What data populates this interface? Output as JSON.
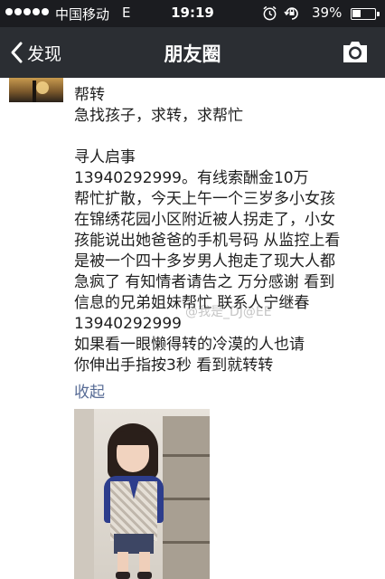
{
  "status_bar": {
    "carrier": "中国移动",
    "network": "E",
    "time": "19:19",
    "battery_percent": "39%",
    "battery_level": 0.39
  },
  "nav": {
    "back_label": "发现",
    "title": "朋友圈"
  },
  "post": {
    "lines": [
      "帮转",
      "急找孩子，求转，求帮忙",
      "",
      "寻人启事",
      "13940292999。有线索酬金10万",
      "帮忙扩散，今天上午一个三岁多小女孩",
      "在锦绣花园小区附近被人拐走了，小女",
      "孩能说出她爸爸的手机号码 从监控上看",
      "是被一个四十多岁男人抱走了现大人都",
      "急疯了 有知情者请告之 万分感谢 看到",
      "信息的兄弟姐妹帮忙 联系人宁继春",
      "13940292999",
      "如果看一眼懒得转的冷漠的人也请",
      "你伸出手指按3秒 看到就转转"
    ],
    "collapse_label": "收起",
    "watermark": "@我是_DJ@EE"
  },
  "icons": {
    "back": "chevron-left-icon",
    "camera": "camera-icon",
    "alarm": "alarm-clock-icon",
    "rotation_lock": "rotation-lock-icon",
    "battery": "battery-icon"
  },
  "colors": {
    "status_bar_bg": "#1b1c20",
    "nav_bg": "#2b2e33",
    "link": "#576b95"
  }
}
